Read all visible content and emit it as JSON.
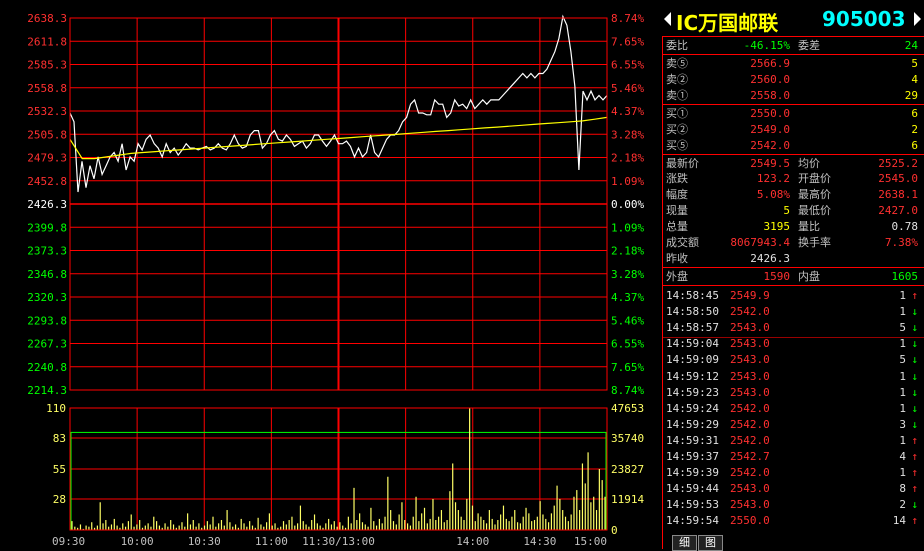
{
  "quote": {
    "name": "IC万国邮联",
    "code": "905003",
    "rows": [
      {
        "label": "委比",
        "value": "-46.15%",
        "label2": "委差",
        "value2": "24"
      },
      {
        "label": "卖⑤",
        "value": "2566.9",
        "vol": "5"
      },
      {
        "label": "卖②",
        "value": "2560.0",
        "vol": "4"
      },
      {
        "label": "卖①",
        "value": "2558.0",
        "vol": "29"
      },
      {
        "label": "买①",
        "value": "2550.0",
        "vol": "6"
      },
      {
        "label": "买②",
        "value": "2549.0",
        "vol": "2"
      },
      {
        "label": "买⑤",
        "value": "2542.0",
        "vol": "6"
      }
    ],
    "stats": [
      {
        "label": "最新价",
        "value": "2549.5",
        "label2": "均价",
        "value2": "2525.2"
      },
      {
        "label": "涨跌",
        "value": "123.2",
        "label2": "开盘价",
        "value2": "2545.0"
      },
      {
        "label": "幅度",
        "value": "5.08%",
        "label2": "最高价",
        "value2": "2638.1"
      },
      {
        "label": "现量",
        "value": "5",
        "label2": "最低价",
        "value2": "2427.0"
      },
      {
        "label": "总量",
        "value": "3195",
        "label2": "量比",
        "value2": "0.78"
      },
      {
        "label": "成交额",
        "value": "8067943.4",
        "label2": "换手率",
        "value2": "7.38%"
      },
      {
        "label": "昨收",
        "value": "2426.3",
        "label2": "",
        "value2": ""
      }
    ],
    "outer_label": "外盘",
    "outer_value": "1590",
    "inner_label": "内盘",
    "inner_value": "1605"
  },
  "ticks": [
    {
      "time": "14:58:45",
      "price": "2549.9",
      "vol": "1",
      "dir": "up"
    },
    {
      "time": "14:58:50",
      "price": "2542.0",
      "vol": "1",
      "dir": "down"
    },
    {
      "time": "14:58:57",
      "price": "2543.0",
      "vol": "5",
      "dir": "down"
    },
    {
      "time": "14:59:04",
      "price": "2543.0",
      "vol": "1",
      "dir": "down"
    },
    {
      "time": "14:59:09",
      "price": "2543.0",
      "vol": "5",
      "dir": "down"
    },
    {
      "time": "14:59:12",
      "price": "2543.0",
      "vol": "1",
      "dir": "down"
    },
    {
      "time": "14:59:23",
      "price": "2543.0",
      "vol": "1",
      "dir": "down"
    },
    {
      "time": "14:59:24",
      "price": "2542.0",
      "vol": "1",
      "dir": "down"
    },
    {
      "time": "14:59:29",
      "price": "2542.0",
      "vol": "3",
      "dir": "down"
    },
    {
      "time": "14:59:31",
      "price": "2542.0",
      "vol": "1",
      "dir": "up"
    },
    {
      "time": "14:59:37",
      "price": "2542.7",
      "vol": "4",
      "dir": "up"
    },
    {
      "time": "14:59:39",
      "price": "2542.0",
      "vol": "1",
      "dir": "up"
    },
    {
      "time": "14:59:44",
      "price": "2543.0",
      "vol": "8",
      "dir": "up"
    },
    {
      "time": "14:59:53",
      "price": "2543.0",
      "vol": "2",
      "dir": "down"
    },
    {
      "time": "14:59:54",
      "price": "2550.0",
      "vol": "14",
      "dir": "up"
    }
  ],
  "tabs": [
    "细",
    "图"
  ],
  "colors": {
    "up": "#ff3030",
    "down": "#00ff00",
    "grid": "#ff0000",
    "price": "#ffffff",
    "avg": "#ffff00",
    "vol": "#ffff66"
  },
  "chart_data": {
    "type": "line",
    "price_axis": {
      "left": [
        "2638.3",
        "2611.8",
        "2585.3",
        "2558.8",
        "2532.3",
        "2505.8",
        "2479.3",
        "2452.8",
        "2426.3",
        "2399.8",
        "2373.3",
        "2346.8",
        "2320.3",
        "2293.8",
        "2267.3",
        "2240.8",
        "2214.3"
      ],
      "right": [
        "8.74%",
        "7.65%",
        "6.55%",
        "5.46%",
        "4.37%",
        "3.28%",
        "2.18%",
        "1.09%",
        "0.00%",
        "1.09%",
        "2.18%",
        "3.28%",
        "4.37%",
        "5.46%",
        "6.55%",
        "7.65%",
        "8.74%"
      ],
      "range": [
        2214.3,
        2638.3
      ],
      "prev_close": 2426.3
    },
    "volume_axis": {
      "left": [
        "110",
        "83",
        "55",
        "28"
      ],
      "right": [
        "47653",
        "35740",
        "23827",
        "11914",
        "0"
      ],
      "range": [
        0,
        110
      ]
    },
    "x_labels": [
      "09:30",
      "10:00",
      "10:30",
      "11:00",
      "11:30/13:00",
      "14:00",
      "14:30",
      "15:00"
    ],
    "price_series": [
      2530,
      2520,
      2440,
      2475,
      2445,
      2470,
      2455,
      2480,
      2460,
      2470,
      2480,
      2485,
      2475,
      2495,
      2465,
      2480,
      2475,
      2495,
      2488,
      2500,
      2505,
      2495,
      2490,
      2480,
      2495,
      2485,
      2490,
      2482,
      2488,
      2495,
      2490,
      2490,
      2488,
      2490,
      2492,
      2488,
      2490,
      2495,
      2490,
      2488,
      2495,
      2505,
      2495,
      2490,
      2492,
      2505,
      2510,
      2510,
      2490,
      2495,
      2505,
      2510,
      2500,
      2498,
      2505,
      2500,
      2492,
      2495,
      2498,
      2490,
      2495,
      2505,
      2505,
      2498,
      2492,
      2498,
      2505,
      2495,
      2495,
      2498,
      2492,
      2480,
      2490,
      2480,
      2485,
      2505,
      2485,
      2480,
      2490,
      2500,
      2505,
      2505,
      2510,
      2520,
      2525,
      2540,
      2545,
      2530,
      2530,
      2528,
      2528,
      2545,
      2540,
      2540,
      2525,
      2530,
      2545,
      2538,
      2540,
      2535,
      2545,
      2535,
      2540,
      2545,
      2540,
      2545,
      2545,
      2545,
      2550,
      2555,
      2560,
      2565,
      2570,
      2575,
      2570,
      2575,
      2570,
      2575,
      2575,
      2580,
      2590,
      2600,
      2615,
      2640,
      2630,
      2600,
      2560,
      2465,
      2555,
      2545,
      2555,
      2545,
      2550,
      2545,
      2550
    ],
    "avg_series": [
      2500,
      2478,
      2478,
      2480,
      2482,
      2484,
      2485,
      2486,
      2487,
      2488,
      2489,
      2490,
      2491,
      2492,
      2493,
      2494,
      2495,
      2496,
      2497,
      2498,
      2499,
      2500,
      2501,
      2502,
      2503,
      2504,
      2505,
      2506,
      2507,
      2508,
      2509,
      2510,
      2511,
      2512,
      2513,
      2514,
      2515,
      2516,
      2517,
      2518,
      2519,
      2520,
      2521,
      2523,
      2525
    ],
    "volume_series": [
      8,
      3,
      2,
      5,
      1,
      4,
      3,
      7,
      2,
      4,
      25,
      6,
      9,
      3,
      5,
      10,
      4,
      2,
      6,
      3,
      8,
      14,
      3,
      5,
      9,
      2,
      4,
      6,
      3,
      12,
      8,
      4,
      2,
      6,
      3,
      9,
      5,
      2,
      4,
      7,
      3,
      15,
      5,
      9,
      3,
      6,
      2,
      4,
      8,
      5,
      12,
      3,
      6,
      9,
      4,
      18,
      7,
      3,
      5,
      2,
      10,
      6,
      3,
      8,
      4,
      2,
      11,
      5,
      3,
      7,
      15,
      4,
      6,
      2,
      3,
      8,
      5,
      9,
      12,
      4,
      6,
      22,
      8,
      5,
      3,
      9,
      14,
      6,
      4,
      2,
      6,
      10,
      5,
      8,
      3,
      7,
      4,
      2,
      12,
      6,
      38,
      9,
      15,
      7,
      5,
      3,
      20,
      8,
      4,
      10,
      6,
      12,
      48,
      18,
      8,
      5,
      14,
      25,
      9,
      6,
      4,
      12,
      30,
      8,
      15,
      20,
      6,
      10,
      28,
      9,
      12,
      18,
      7,
      9,
      35,
      60,
      25,
      18,
      12,
      9,
      28,
      110,
      22,
      8,
      15,
      12,
      9,
      6,
      18,
      10,
      5,
      9,
      14,
      22,
      10,
      8,
      12,
      18,
      7,
      6,
      12,
      20,
      15,
      8,
      9,
      12,
      26,
      14,
      10,
      7,
      15,
      22,
      40,
      28,
      18,
      12,
      8,
      14,
      30,
      36,
      18,
      60,
      42,
      70,
      25,
      30,
      18,
      55,
      45,
      30
    ]
  }
}
